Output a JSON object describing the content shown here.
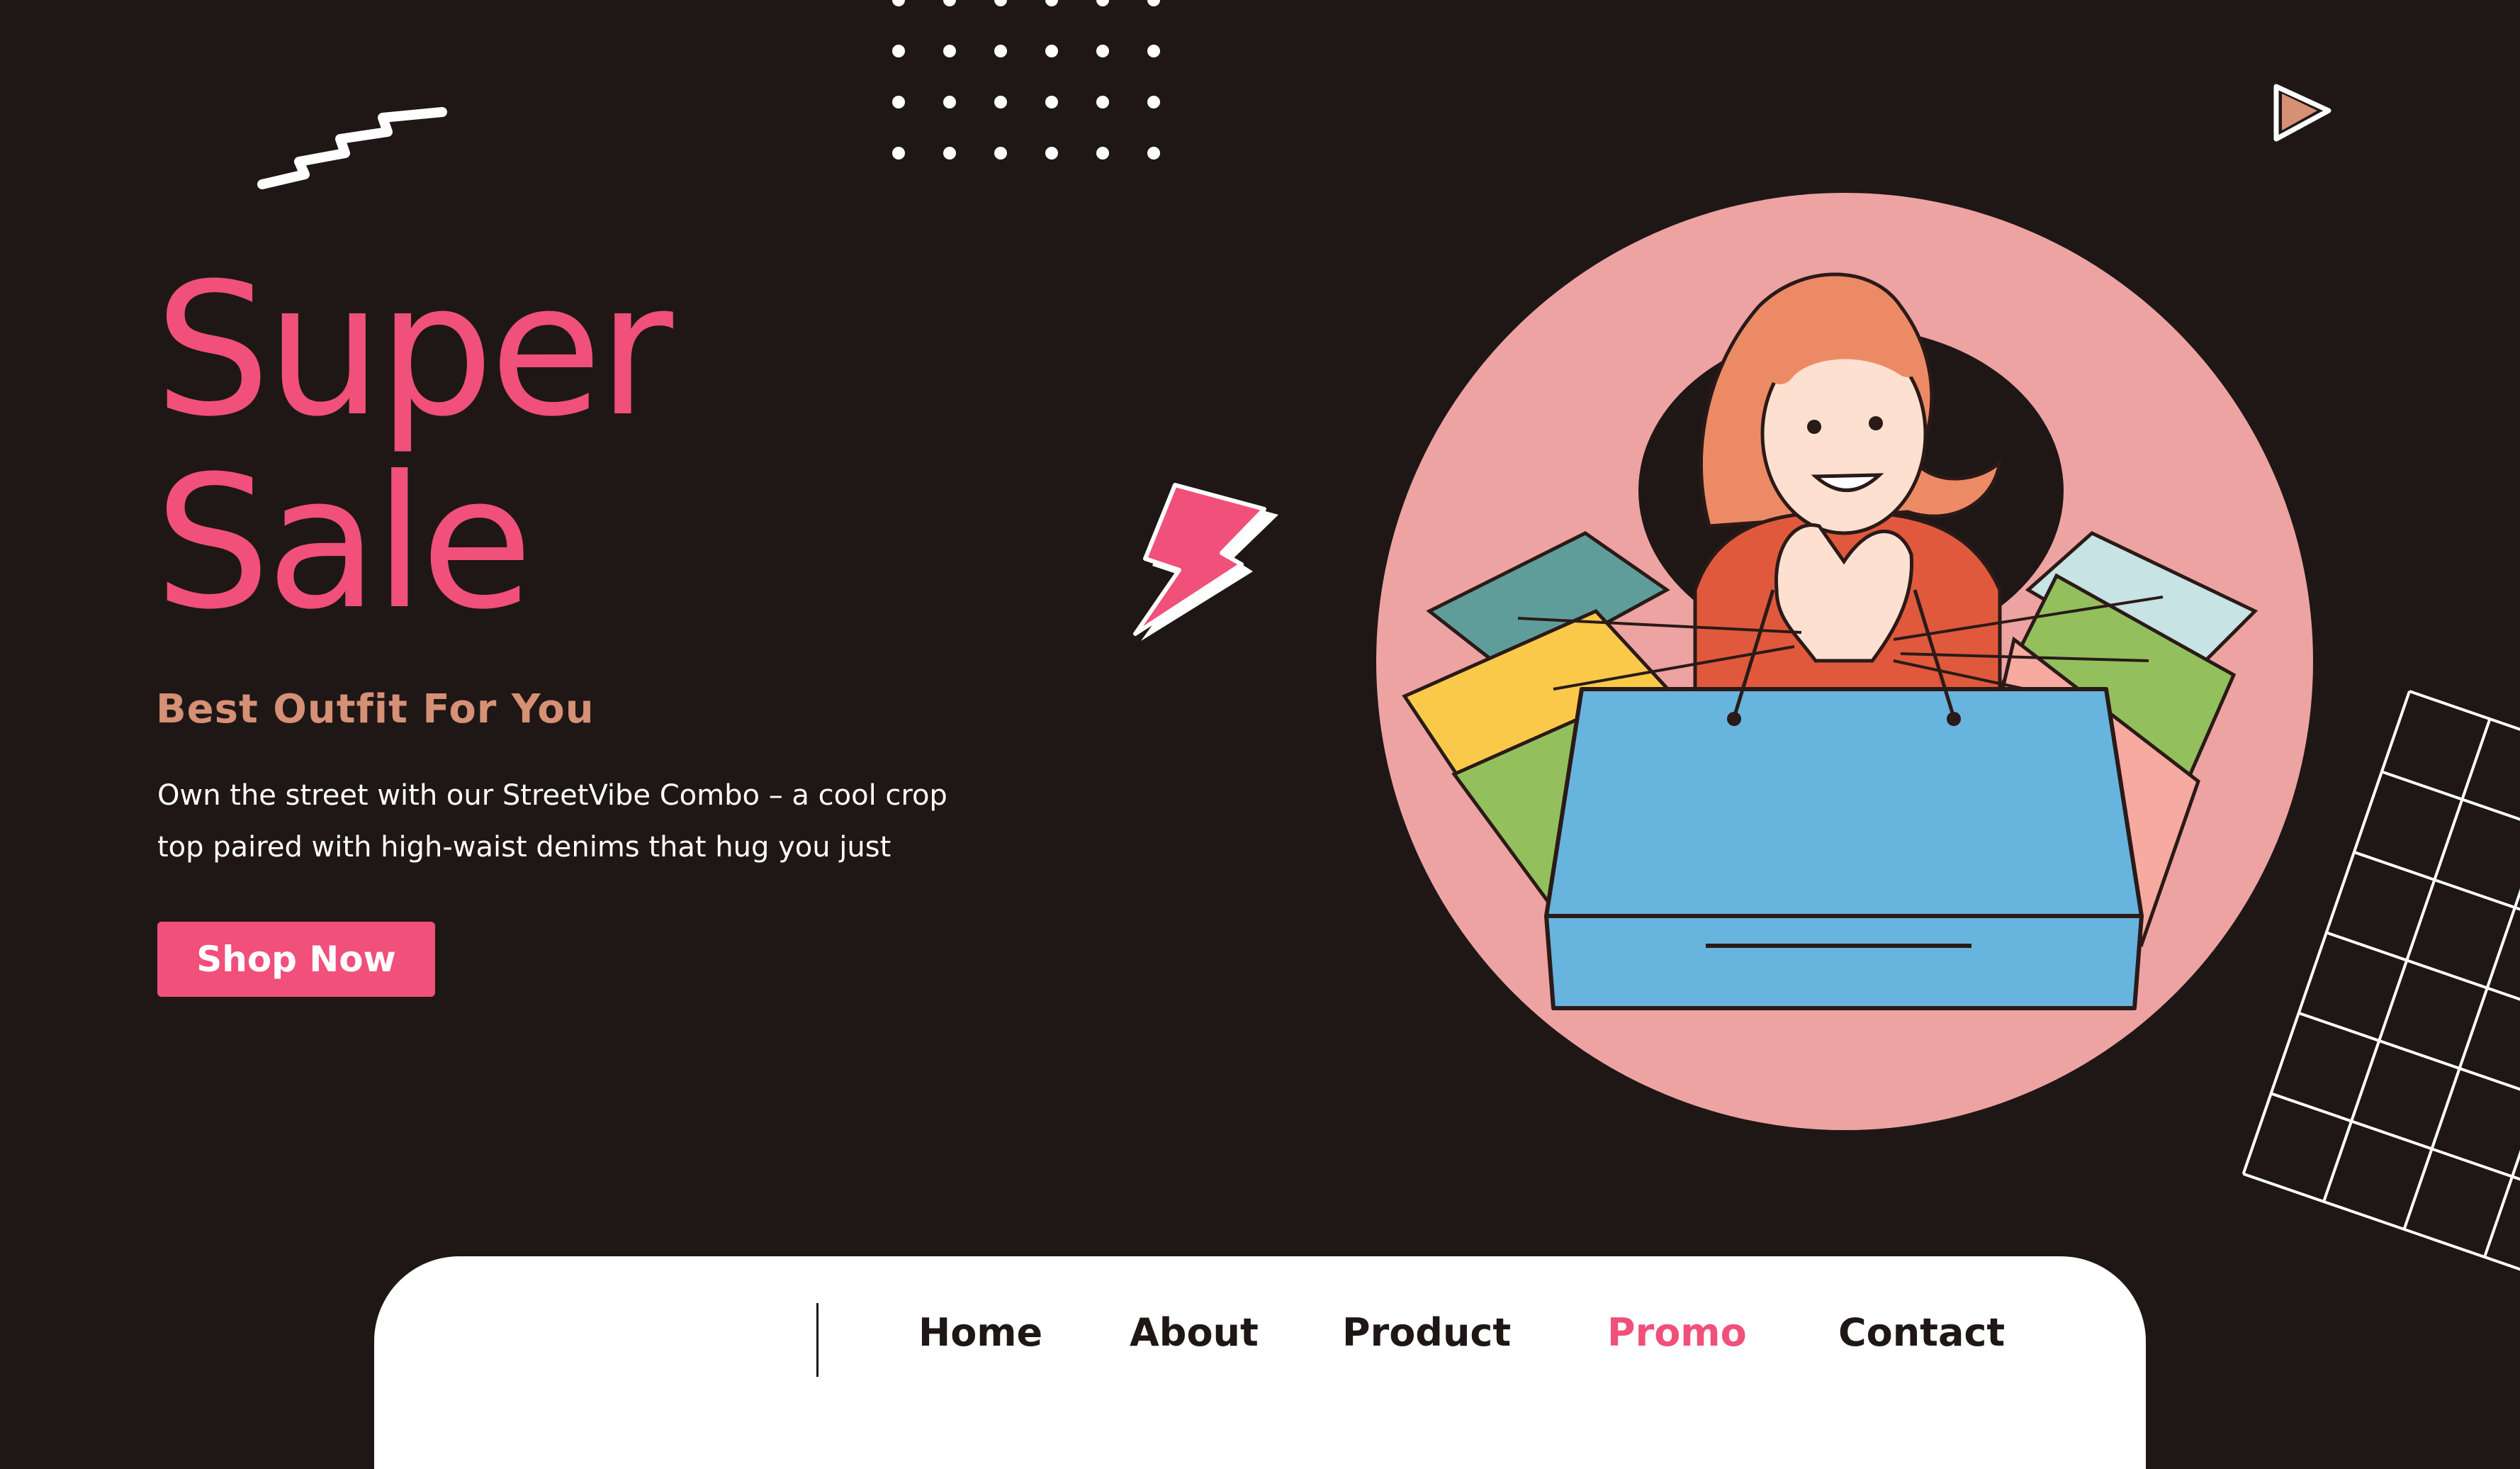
{
  "hero": {
    "title_line1": "Super",
    "title_line2": "Sale",
    "subtitle": "Best Outfit For You",
    "description": "Own the street with our StreetVibe Combo – a cool crop top paired with high-waist denims that hug you just",
    "cta_label": "Shop Now"
  },
  "nav": {
    "items": [
      {
        "label": "Home"
      },
      {
        "label": "About"
      },
      {
        "label": "Product"
      },
      {
        "label": "Promo",
        "active": true
      },
      {
        "label": "Contact"
      }
    ]
  },
  "icons": {
    "zigzag": "zigzag-icon",
    "dots": "dot-grid-icon",
    "play": "play-icon",
    "lightning": "lightning-bolt-icon",
    "grid": "grid-pattern-icon"
  },
  "colors": {
    "background": "#1e1716",
    "accent": "#f0507a",
    "subtitle": "#d69075",
    "circle": "#eda3a2",
    "nav_background": "#ffffff"
  }
}
